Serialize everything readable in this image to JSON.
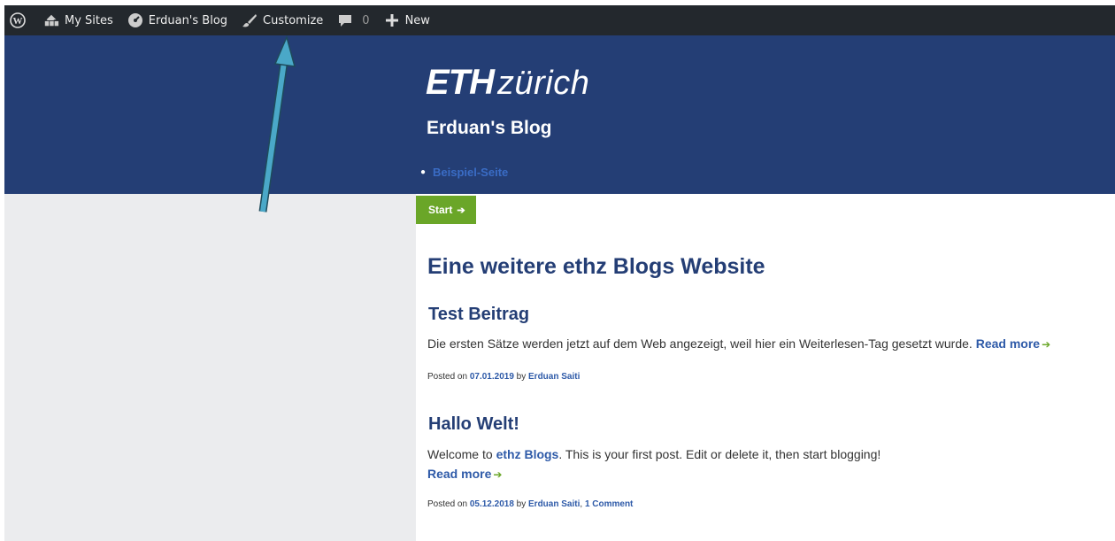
{
  "adminbar": {
    "my_sites": "My Sites",
    "site_name": "Erduan's Blog",
    "customize": "Customize",
    "comments_count": "0",
    "new": "New",
    "icons": [
      "wordpress-icon",
      "my-sites-icon",
      "dashboard-icon",
      "brush-icon",
      "comment-icon",
      "plus-icon"
    ]
  },
  "header": {
    "logo_eth": "ETH",
    "logo_zurich": "zürich",
    "site_title": "Erduan's Blog",
    "nav_items": [
      "Beispiel-Seite"
    ]
  },
  "breadcrumb": {
    "start": "Start",
    "arrow": "➔"
  },
  "main": {
    "page_heading": "Eine weitere ethz Blogs Website",
    "posts": [
      {
        "title": "Test Beitrag",
        "excerpt": "Die ersten Sätze werden jetzt auf dem Web angezeigt, weil hier ein Weiterlesen-Tag gesetzt wurde.",
        "read_more": "Read more",
        "posted_on": "Posted on",
        "date": "07.01.2019",
        "by": "by",
        "author": "Erduan Saiti",
        "comments": ""
      },
      {
        "title": "Hallo Welt!",
        "excerpt_prefix": "Welcome to",
        "excerpt_link": "ethz Blogs",
        "excerpt_suffix": ". This is your first post. Edit or delete it, then start blogging!",
        "read_more": "Read more",
        "posted_on": "Posted on",
        "date": "05.12.2018",
        "by": "by",
        "author": "Erduan Saiti",
        "comments": "1 Comment"
      }
    ]
  },
  "colors": {
    "adminbar_bg": "#23282d",
    "header_bg": "#243e75",
    "accent_green": "#6aa628",
    "link_blue": "#2e5aa8",
    "annotation_arrow": "#4aa8c8"
  }
}
